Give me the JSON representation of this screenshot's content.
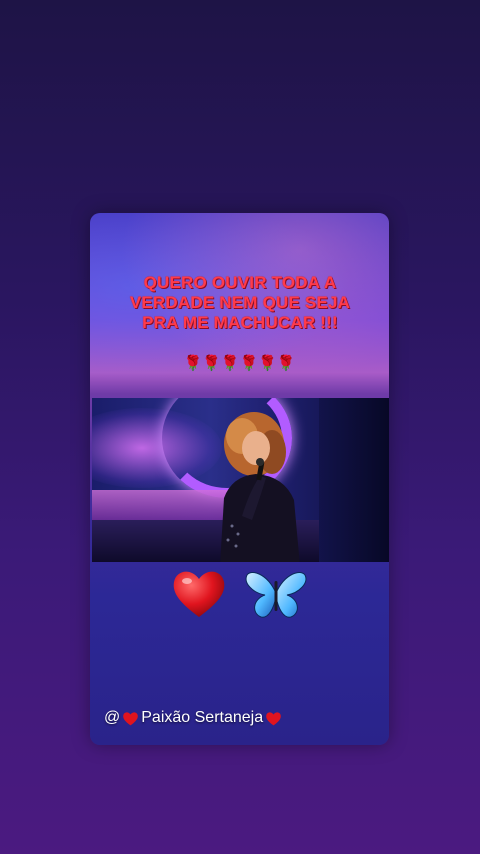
{
  "post": {
    "quote": "QUERO OUVIR TODA A VERDADE NEM QUE SEJA PRA ME MACHUCAR !!!",
    "roses": "🌹🌹🌹🌹🌹🌹",
    "handle_prefix": "@",
    "handle_name": "Paixão Sertaneja"
  },
  "icons": {
    "heart": "heart-icon",
    "butterfly": "butterfly-icon",
    "rose": "rose-icon"
  },
  "colors": {
    "quote_text": "#ff3b4a",
    "heart": "#e0141e",
    "butterfly": "#4fb8ff"
  }
}
